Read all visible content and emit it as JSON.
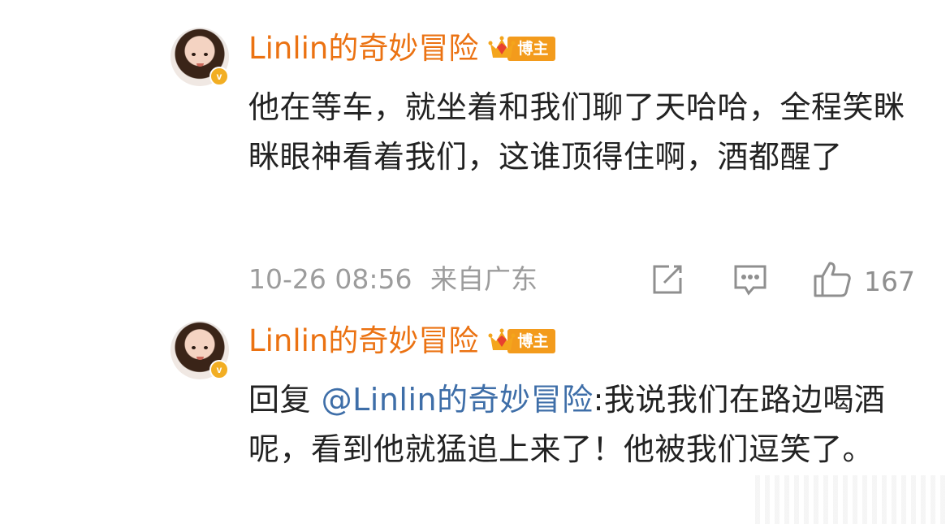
{
  "comments": [
    {
      "author": "Linlin的奇妙冒险",
      "badge": "博主",
      "verified_mark": "v",
      "text": "他在等车，就坐着和我们聊了天哈哈，全程笑眯眯眼神看着我们，这谁顶得住啊，酒都醒了",
      "timestamp": "10-26 08:56",
      "location": "来自广东",
      "likes": "167"
    },
    {
      "author": "Linlin的奇妙冒险",
      "badge": "博主",
      "verified_mark": "v",
      "reply_prefix": "回复",
      "mention": "@Linlin的奇妙冒险",
      "text": ":我说我们在路边喝酒呢，看到他就猛追上来了！他被我们逗笑了。"
    }
  ],
  "icons": [
    "share-icon",
    "comment-icon",
    "like-icon",
    "crown-icon",
    "verified-icon"
  ],
  "colors": {
    "author": "#eb7212",
    "badge": "#f39b1c",
    "mention": "#3e6ea8",
    "meta": "#9c9c9c",
    "verified": "#f2ae23"
  }
}
